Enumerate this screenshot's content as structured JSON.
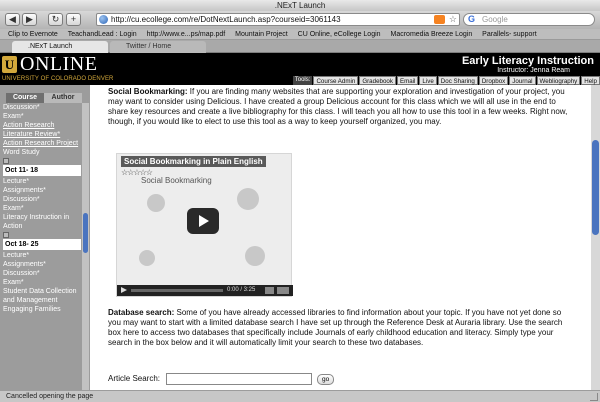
{
  "window": {
    "title": ".NExT Launch"
  },
  "toolbar": {
    "back": "◀",
    "forward": "▶",
    "reload": "↻",
    "new_tab": "+",
    "url": "http://cu.ecollege.com/re/DotNextLaunch.asp?courseid=3061143",
    "search_placeholder": "Google"
  },
  "bookmarks": [
    "Clip to Evernote",
    "TeachandLead : Login",
    "http://www.e...ps/map.pdf",
    "Mountain Project",
    "CU Online, eCollege Login",
    "Macromedia Breeze Login",
    "Parallels- support"
  ],
  "tabs": [
    {
      "label": ".NExT Launch",
      "active": true
    },
    {
      "label": "Twitter / Home",
      "active": false
    }
  ],
  "header": {
    "logo_mark": "U",
    "logo_text": "ONLINE",
    "university": "UNIVERSITY OF COLORADO DENVER",
    "course_title": "Early Literacy Instruction",
    "instructor": "Instructor: Jenna Ream",
    "tools_label": "Tools:",
    "tools": [
      "Course Admin",
      "Gradebook",
      "Email",
      "Live",
      "Doc Sharing",
      "Dropbox",
      "Journal",
      "Webliography",
      "Help"
    ]
  },
  "leftnav": {
    "tab_course": "Course",
    "tab_author": "Author",
    "items": [
      {
        "text": "Discussion*",
        "kind": "item"
      },
      {
        "text": "Exam*",
        "kind": "item"
      },
      {
        "text": "Action Research Literature Review*",
        "kind": "link"
      },
      {
        "text": "Action Research Project",
        "kind": "link"
      },
      {
        "text": "Word Study",
        "kind": "item"
      },
      {
        "text": "",
        "kind": "box"
      },
      {
        "text": "Oct 11- 18",
        "kind": "unit"
      },
      {
        "text": "Lecture*",
        "kind": "item"
      },
      {
        "text": "Assignments*",
        "kind": "item"
      },
      {
        "text": "Discussion*",
        "kind": "item"
      },
      {
        "text": "Exam*",
        "kind": "item"
      },
      {
        "text": "Literacy Instruction in Action",
        "kind": "item"
      },
      {
        "text": "",
        "kind": "box"
      },
      {
        "text": "Oct 18- 25",
        "kind": "unit"
      },
      {
        "text": "Lecture*",
        "kind": "item"
      },
      {
        "text": "Assignments*",
        "kind": "item"
      },
      {
        "text": "Discussion*",
        "kind": "item"
      },
      {
        "text": "Exam*",
        "kind": "item"
      },
      {
        "text": "Student Data Collection and Management",
        "kind": "item"
      },
      {
        "text": "Engaging Families",
        "kind": "item"
      }
    ]
  },
  "content": {
    "p1_heading": "Social Bookmarking:",
    "p1_text": " If you are finding many websites that are supporting your exploration and investigation of your project, you may want to consider using Delicious.  I have created a group Delicious account for this class which we will all use in the end to share key resources and create a live bibliography for this class.  I will teach you all how to use this tool in a few weeks.  Right now, though, if you would like to elect to use this tool as a way to keep yourself organized, you may.",
    "video": {
      "title": "Social Bookmarking in Plain English",
      "stars": "☆☆☆☆☆",
      "subtitle": "Social Bookmarking",
      "time": "0:00 / 3:25"
    },
    "p2_heading": "Database search:",
    "p2_text": " Some of you have already accessed libraries to find information about your topic. If you have not yet done so you may want to start with a limited database search I have set up through the Reference Desk at Auraria library.  Use the search box here to access two databases that specifically include Journals of early childhood education and literacy.  Simply type your search in the box below and it will automatically limit your search to these two databases.",
    "search_label": "Article Search:",
    "search_value": "",
    "go_label": "go"
  },
  "statusbar": {
    "text": "Cancelled opening the page"
  }
}
